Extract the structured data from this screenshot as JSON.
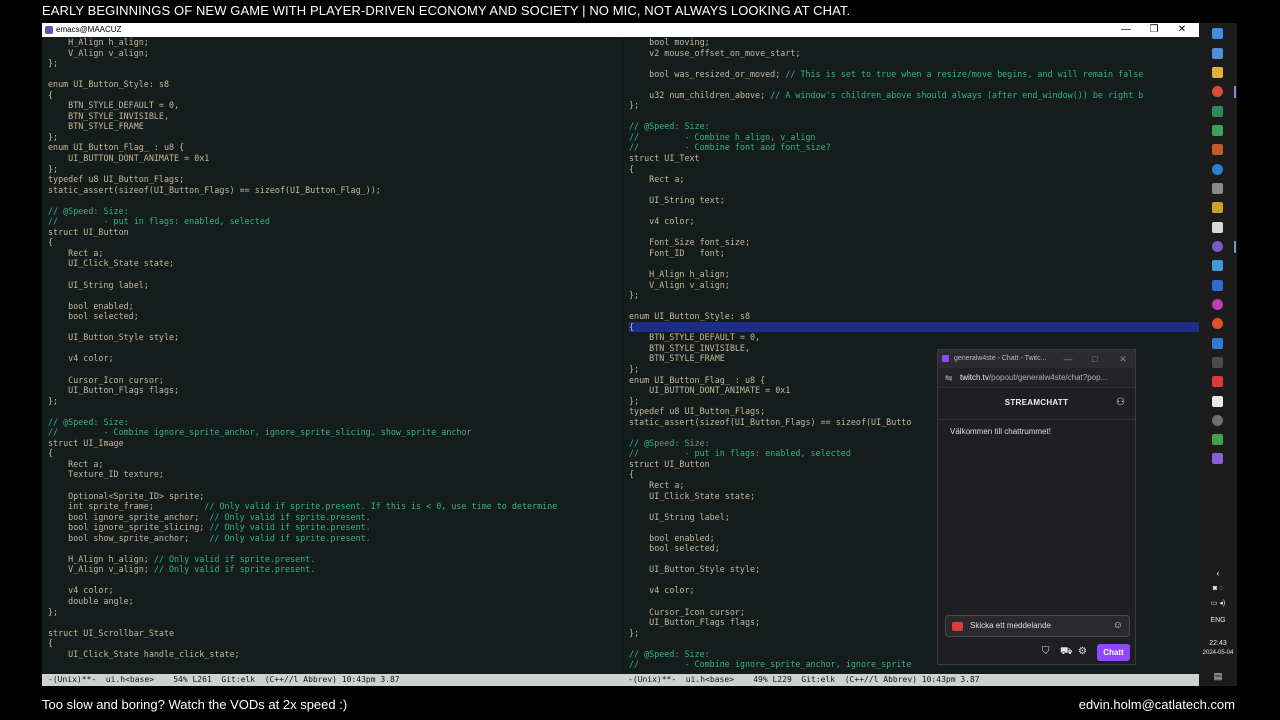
{
  "stream": {
    "title": "EARLY BEGINNINGS OF NEW GAME WITH PLAYER-DRIVEN ECONOMY AND SOCIETY | NO MIC, NOT ALWAYS LOOKING AT CHAT.",
    "bottom_left": "Too slow and boring? Watch the VODs at 2x speed :)",
    "bottom_right": "edvin.holm@catlatech.com"
  },
  "emacs": {
    "window_title": "emacs@MAACUZ",
    "minimize": "—",
    "maximize": "❐",
    "close": "✕",
    "left_pane_lines": [
      "    H_Align h_align;",
      "    V_Align v_align;",
      "};",
      "",
      "enum UI_Button_Style: s8",
      "{",
      "    BTN_STYLE_DEFAULT = 0,",
      "    BTN_STYLE_INVISIBLE,",
      "    BTN_STYLE_FRAME",
      "};",
      "enum UI_Button_Flag_ : u8 {",
      "    UI_BUTTON_DONT_ANIMATE = 0x1",
      "};",
      "typedef u8 UI_Button_Flags;",
      "static_assert(sizeof(UI_Button_Flags) == sizeof(UI_Button_Flag_));",
      "",
      "// @Speed: Size:",
      "//         - put in flags: enabled, selected",
      "struct UI_Button",
      "{",
      "    Rect a;",
      "    UI_Click_State state;",
      "",
      "    UI_String label;",
      "",
      "    bool enabled;",
      "    bool selected;",
      "",
      "    UI_Button_Style style;",
      "",
      "    v4 color;",
      "",
      "    Cursor_Icon cursor;",
      "    UI_Button_Flags flags;",
      "};",
      "",
      "// @Speed: Size:",
      "//         - Combine ignore_sprite_anchor, ignore_sprite_slicing, show_sprite_anchor",
      "struct UI_Image",
      "{",
      "    Rect a;",
      "    Texture_ID texture;",
      "",
      "    Optional<Sprite_ID> sprite;",
      "    int sprite_frame;          // Only valid if sprite.present. If this is < 0, use time to determine",
      "    bool ignore_sprite_anchor;  // Only valid if sprite.present.",
      "    bool ignore_sprite_slicing; // Only valid if sprite.present.",
      "    bool show_sprite_anchor;    // Only valid if sprite.present.",
      "",
      "    H_Align h_align; // Only valid if sprite.present.",
      "    V_Align v_align; // Only valid if sprite.present.",
      "",
      "    v4 color;",
      "    double angle;",
      "};",
      "",
      "struct UI_Scrollbar_State",
      "{",
      "    UI_Click_State handle_click_state;"
    ],
    "right_pane_lines": [
      "    bool moving;",
      "    v2 mouse_offset_on_move_start;",
      "",
      "    bool was_resized_or_moved; // This is set to true when a resize/move begins, and will remain false",
      "",
      "    u32 num_children_above; // A window's children_above should always (after end_window()) be right b",
      "};",
      "",
      "// @Speed: Size:",
      "//         - Combine h_align, v_align",
      "//         - Combine font and font_size?",
      "struct UI_Text",
      "{",
      "    Rect a;",
      "",
      "    UI_String text;",
      "",
      "    v4 color;",
      "",
      "    Font_Size font_size;",
      "    Font_ID   font;",
      "",
      "    H_Align h_align;",
      "    V_Align v_align;",
      "};",
      "",
      "enum UI_Button_Style: s8",
      "{",
      "    BTN_STYLE_DEFAULT = 0,",
      "    BTN_STYLE_INVISIBLE,",
      "    BTN_STYLE_FRAME",
      "};",
      "enum UI_Button_Flag_ : u8 {",
      "    UI_BUTTON_DONT_ANIMATE = 0x1",
      "};",
      "typedef u8 UI_Button_Flags;",
      "static_assert(sizeof(UI_Button_Flags) == sizeof(UI_Butto",
      "",
      "// @Speed: Size:",
      "//         - put in flags: enabled, selected",
      "struct UI_Button",
      "{",
      "    Rect a;",
      "    UI_Click_State state;",
      "",
      "    UI_String label;",
      "",
      "    bool enabled;",
      "    bool selected;",
      "",
      "    UI_Button_Style style;",
      "",
      "    v4 color;",
      "",
      "    Cursor_Icon cursor;",
      "    UI_Button_Flags flags;",
      "};",
      "",
      "// @Speed: Size:",
      "//         - Combine ignore_sprite_anchor, ignore_sprite"
    ],
    "modeline_left": "-(Unix)**-  ui.h<base>    54% L261  Git:elk  (C++//l Abbrev) 10:43pm 3.87",
    "modeline_right": "-(Unix)**-  ui.h<base>    49% L229  Git:elk  (C++//l Abbrev) 10:43pm 3.87"
  },
  "chat": {
    "window_title": "generalw4ste - Chatt - Twitc...",
    "url_host": "twitch.tv",
    "url_path": "/popout/generalw4ste/chat?pop...",
    "header": "STREAMCHATT",
    "welcome": "Välkommen till chattrummet!",
    "input_placeholder": "Skicka ett meddelande",
    "send_label": "Chatt",
    "accent": "#9147ff"
  },
  "taskbar": {
    "language": "ENG",
    "time": "22:43",
    "date": "2024-05-04",
    "icons": [
      "windows-logo-icon",
      "browser-icon",
      "folder-icon",
      "chrome-icon",
      "terminal-icon",
      "app-icon",
      "app-icon",
      "app-icon",
      "app-icon",
      "app-icon",
      "emacs-icon",
      "app-icon",
      "app-icon",
      "app-icon",
      "app-icon",
      "app-icon",
      "app-icon",
      "app-icon",
      "app-icon",
      "app-icon",
      "app-icon",
      "app-icon",
      "visual-studio-icon"
    ]
  }
}
